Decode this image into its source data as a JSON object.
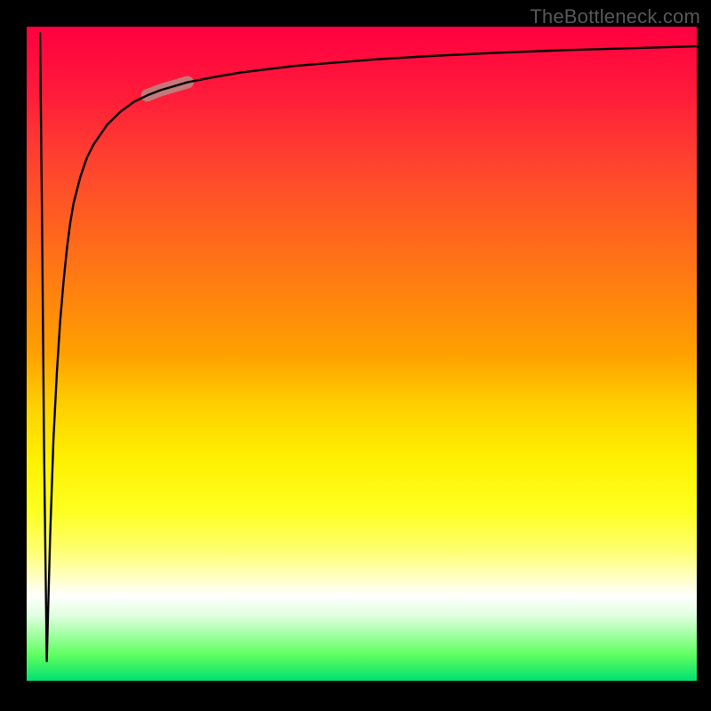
{
  "attribution": "TheBottleneck.com",
  "colors": {
    "top": "#ff0040",
    "bottom": "#00e070",
    "frame": "#000000",
    "curve": "#000000",
    "highlight": "#b88a86"
  },
  "chart_data": {
    "type": "line",
    "title": "",
    "xlabel": "",
    "ylabel": "",
    "xlim": [
      0,
      100
    ],
    "ylim": [
      0,
      100
    ],
    "grid": false,
    "curve_description": "steep spike down near x≈3 then rises back and asymptotically approaches ~97",
    "x": [
      2.0,
      2.3,
      2.6,
      3.0,
      3.5,
      4.0,
      4.5,
      5.0,
      5.5,
      6.0,
      6.5,
      7.0,
      8.0,
      9.0,
      10,
      12,
      14,
      16,
      18,
      20,
      24,
      28,
      32,
      36,
      40,
      46,
      52,
      60,
      70,
      80,
      90,
      100
    ],
    "y": [
      99,
      70,
      35,
      3,
      22,
      37,
      47,
      55,
      61,
      66,
      70,
      73,
      77,
      80,
      82,
      85,
      87,
      88.5,
      89.5,
      90.3,
      91.5,
      92.3,
      93,
      93.5,
      94,
      94.5,
      95,
      95.5,
      96,
      96.4,
      96.7,
      97
    ],
    "highlight_segment": {
      "x_start": 17,
      "x_end": 24,
      "thickness_px": 14
    }
  }
}
